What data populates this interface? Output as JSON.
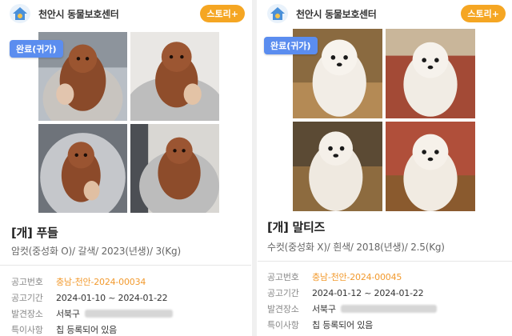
{
  "cards": [
    {
      "org_name": "천안시 동물보호센터",
      "story_label": "스토리+",
      "status_badge": "완료(귀가)",
      "title": "[개] 푸들",
      "desc": "암컷(중성화 O)/ 갈색/ 2023(년생)/ 3(Kg)",
      "rows": [
        {
          "label": "공고번호",
          "value": "충남-천안-2024-00034"
        },
        {
          "label": "공고기간",
          "value": "2024-01-10 ~ 2024-01-22"
        },
        {
          "label": "발견장소",
          "value": "서북구"
        },
        {
          "label": "특이사항",
          "value": "칩 등록되어 있음"
        }
      ]
    },
    {
      "org_name": "천안시 동물보호센터",
      "story_label": "스토리+",
      "status_badge": "완료(귀가)",
      "title": "[개] 말티즈",
      "desc": "수컷(중성화 X)/ 흰색/ 2018(년생)/ 2.5(Kg)",
      "rows": [
        {
          "label": "공고번호",
          "value": "충남-천안-2024-00045"
        },
        {
          "label": "공고기간",
          "value": "2024-01-12 ~ 2024-01-22"
        },
        {
          "label": "발견장소",
          "value": "서북구"
        },
        {
          "label": "특이사항",
          "value": "칩 등록되어 있음"
        }
      ]
    }
  ],
  "colors": {
    "story": "#f5a623",
    "badge": "#5b8def",
    "notice_number": "#f29a2e"
  },
  "icons": {
    "logo": "house-paw-icon"
  }
}
